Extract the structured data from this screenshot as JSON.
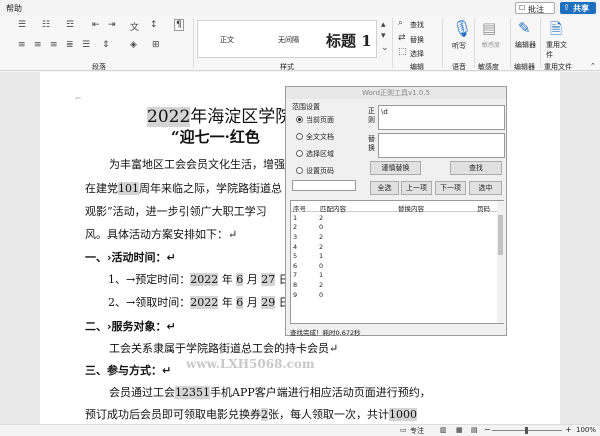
{
  "menubar": {
    "help": "帮助",
    "comment_label": "批注",
    "share_label": "共享"
  },
  "ribbon": {
    "styles": [
      "正文",
      "无间隔",
      "标题 1"
    ],
    "groups": {
      "paragraph": "段落",
      "style": "样式",
      "edit": "编辑",
      "voice": "语音",
      "sensitivity": "敏感度",
      "editor_group": "编辑器",
      "reuse_group": "重用文件"
    },
    "find": "查找",
    "replace": "替换",
    "select": "选择",
    "listen": "听写",
    "sensitivity_btn": "敏感度",
    "editor_btn": "编辑器",
    "reuse_btn": "重用文件"
  },
  "document": {
    "title_year": "2022",
    "title_rest": "年海淀区学院路",
    "subtitle": "“迎七一·红色",
    "p1_line1": "为丰富地区工会会员文化生活，增强",
    "p1_line2_a": "在建党",
    "p1_line2_num": "101",
    "p1_line2_b": "周年来临之际，学院路街道总",
    "p1_line3": "观影”活动，进一步引领广大职工学习",
    "p1_line4": "风。具体活动方案安排如下：↵",
    "h1": "一、›活动时间：↵",
    "t1_a": "1、→预定时间：",
    "t1_y": "2022",
    "t1_b": "年",
    "t1_m": "6",
    "t1_c": "月",
    "t1_d": "27",
    "t1_e": "日",
    "t2_a": "2、→领取时间：",
    "t2_y": "2022",
    "t2_b": "年",
    "t2_m": "6",
    "t2_c": "月",
    "t2_d": "29",
    "t2_e": "日",
    "h2": "二、›服务对象：↵",
    "p2": "工会关系隶属于学院路街道总工会的持卡会员↵",
    "h3": "三、参与方式：↵",
    "p3_a": "会员通过工会",
    "p3_num": "12351",
    "p3_b": "手机APP客户端进行相应活动页面进行预约，",
    "p4_a": "预订成功后会员即可领取电影兑换券",
    "p4_num": "2",
    "p4_b": "张，每人领取一次，共计",
    "p4_num2": "1000",
    "watermark": "www.LXH5068.com"
  },
  "dialog": {
    "title": "Word正则工具v1.0.5",
    "range_label": "范围设置",
    "options": [
      "当前页面",
      "全文文档",
      "选择区域",
      "设置页码"
    ],
    "regex_label": "正则",
    "regex_value": "\\d",
    "replace_label": "替换",
    "buttons": {
      "regex_replace": "谨慎替换",
      "find": "查找",
      "select_all": "全选",
      "prev": "上一项",
      "next": "下一项",
      "selected": "选中"
    },
    "columns": [
      "序号",
      "匹配内容",
      "替换内容",
      "页码"
    ],
    "rows": [
      [
        "1",
        "2",
        ""
      ],
      [
        "2",
        "0",
        ""
      ],
      [
        "3",
        "2",
        ""
      ],
      [
        "4",
        "2",
        ""
      ],
      [
        "5",
        "1",
        ""
      ],
      [
        "6",
        "0",
        ""
      ],
      [
        "7",
        "1",
        ""
      ],
      [
        "8",
        "2",
        ""
      ],
      [
        "9",
        "0",
        ""
      ]
    ],
    "status": "查找完成！耗时0.672秒"
  },
  "status": {
    "focus": "专注",
    "zoom": "100%"
  }
}
